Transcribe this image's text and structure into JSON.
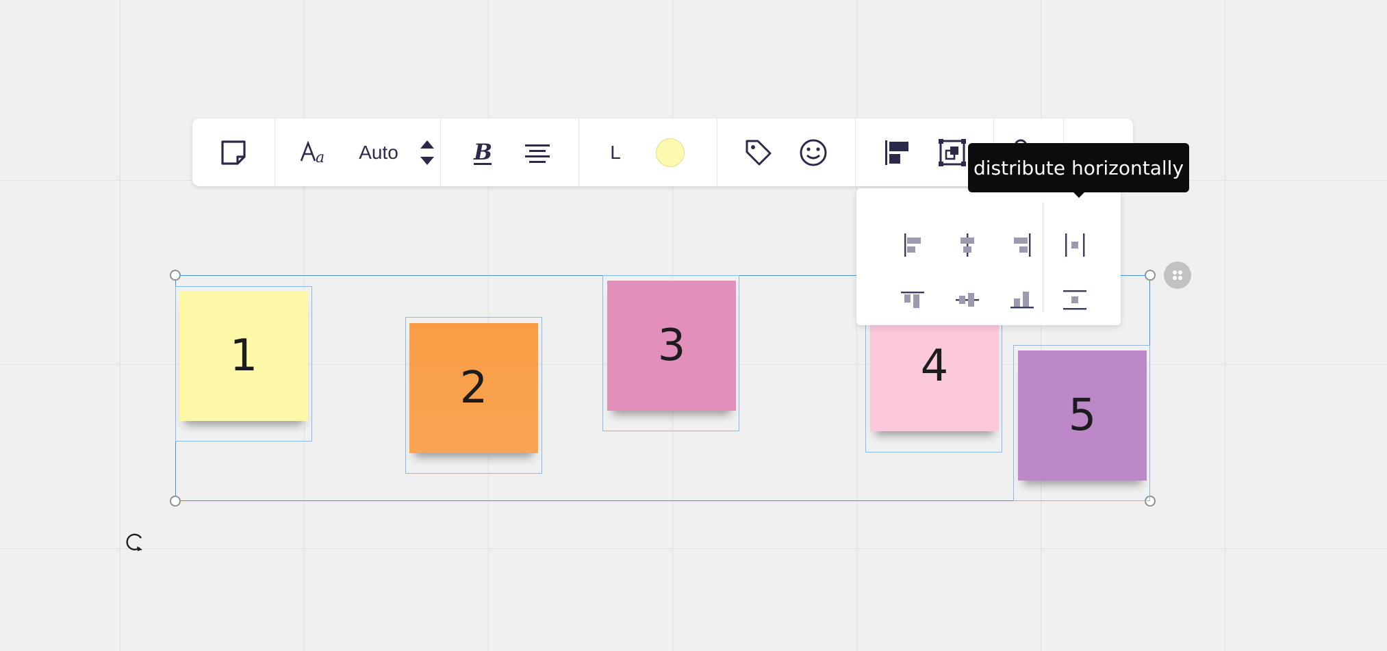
{
  "toolbar": {
    "font_size_value": "Auto",
    "note_size": "L",
    "note_color": "#fef9b0"
  },
  "tooltip": {
    "text": "distribute horizontally"
  },
  "notes": [
    {
      "label": "1",
      "color": "#fdf8a8"
    },
    {
      "label": "2",
      "color": "#f99d45"
    },
    {
      "label": "3",
      "color": "#e28fbb"
    },
    {
      "label": "4",
      "color": "#fbc8dc"
    },
    {
      "label": "5",
      "color": "#bd88c8"
    }
  ],
  "icons": {
    "sticky_note": "sticky-note-icon",
    "font": "font-icon",
    "stepper": "stepper-icon",
    "bold": "bold-icon",
    "text_align": "text-align-center-icon",
    "tag": "tag-icon",
    "emoji": "emoji-icon",
    "align": "align-icon",
    "group": "group-icon",
    "lock": "lock-icon",
    "rotate": "rotate-icon"
  }
}
